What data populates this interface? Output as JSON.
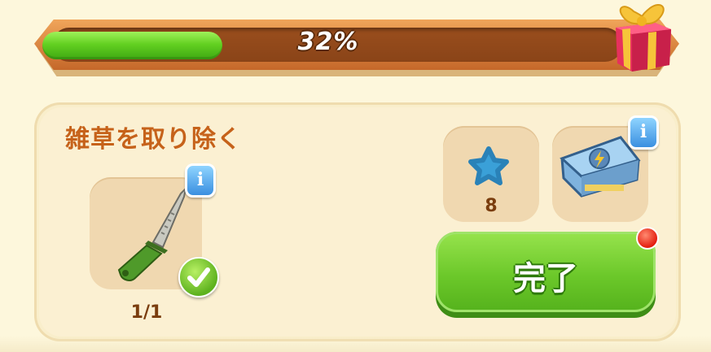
{
  "progress": {
    "percent_label": "32%",
    "fraction": 0.32
  },
  "task": {
    "title": "雑草を取り除く",
    "required_item": {
      "icon": "knife-icon",
      "count_label": "1/1",
      "completed": true
    }
  },
  "rewards": [
    {
      "icon": "blue-star-icon",
      "count_label": "8"
    },
    {
      "icon": "lightning-chest-icon",
      "count_label": ""
    }
  ],
  "done_button": {
    "label": "完了"
  },
  "colors": {
    "accent_green": "#6cc82a",
    "title_orange": "#c6621a",
    "bar_brown": "#8a4418",
    "notification_red": "#e41e10"
  }
}
